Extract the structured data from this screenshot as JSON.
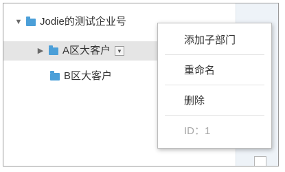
{
  "tree": {
    "root": {
      "label": "Jodie的测试企业号",
      "toggle": "▼",
      "icon": "folder-icon"
    },
    "children": [
      {
        "label": "A区大客户",
        "toggle": "▶",
        "icon": "folder-icon",
        "dropdown": "▼"
      },
      {
        "label": "B区大客户",
        "icon": "folder-icon"
      }
    ]
  },
  "context_menu": {
    "items": [
      {
        "label": "添加子部门",
        "enabled": true
      },
      {
        "label": "重命名",
        "enabled": true
      },
      {
        "label": "删除",
        "enabled": true
      },
      {
        "label": "ID：1",
        "enabled": false
      }
    ]
  },
  "colors": {
    "folder": "#4b9fd8",
    "selected_row": "#e5e5e5",
    "text": "#333333",
    "disabled_text": "#a8a8a8"
  }
}
